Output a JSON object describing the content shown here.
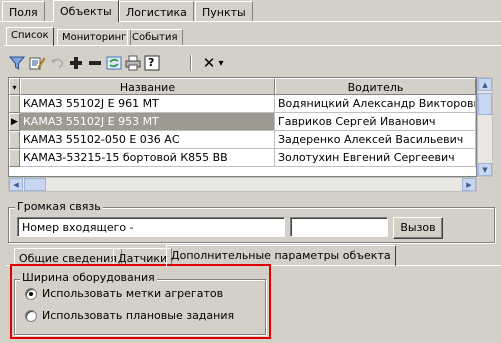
{
  "top_tabs": [
    "Поля",
    "Объекты",
    "Логистика",
    "Пункты"
  ],
  "sub_tabs": [
    "Список",
    "Мониторинг",
    "События"
  ],
  "toolbar": {
    "icons": [
      "filter-icon",
      "edit-filter-icon",
      "undo-icon",
      "add-icon",
      "remove-icon",
      "refresh-icon",
      "print-icon",
      "help-icon",
      "close-icon",
      "dropdown-arrow-icon"
    ],
    "close_glyph": "✕",
    "arrow_glyph": "▾",
    "help_glyph": "?"
  },
  "grid": {
    "columns": [
      "Название",
      "Водитель"
    ],
    "rows": [
      {
        "name": "КАМАЗ 55102J  Е 961 МТ",
        "driver": "Водяницкий Александр Викторович"
      },
      {
        "name": "КАМАЗ 55102J  Е 953 МТ",
        "driver": "Гавриков Сергей Иванович"
      },
      {
        "name": "КАМАЗ 55102-050 Е 036 АС",
        "driver": "Задеренко Алексей Васильевич"
      },
      {
        "name": "КАМАЗ-53215-15 бортовой К855 ВВ",
        "driver": "Золотухин Евгений Сергеевич"
      }
    ],
    "selected_row": 1,
    "current_row_marker": "▶"
  },
  "loud_link": {
    "title": "Громкая связь",
    "incoming_number": "Номер входящего -",
    "call_value": "",
    "call_button": "Вызов"
  },
  "bottom_tabs": [
    "Общие сведения",
    "Датчики",
    "Дополнительные параметры объекта"
  ],
  "equipment_width": {
    "title": "Ширина оборудования",
    "options": [
      {
        "label": "Использовать метки агрегатов",
        "checked": true
      },
      {
        "label": "Использовать плановые задания",
        "checked": false
      }
    ]
  },
  "colors": {
    "highlight_frame": "#e00000",
    "selected_row": "#9d9a90"
  }
}
